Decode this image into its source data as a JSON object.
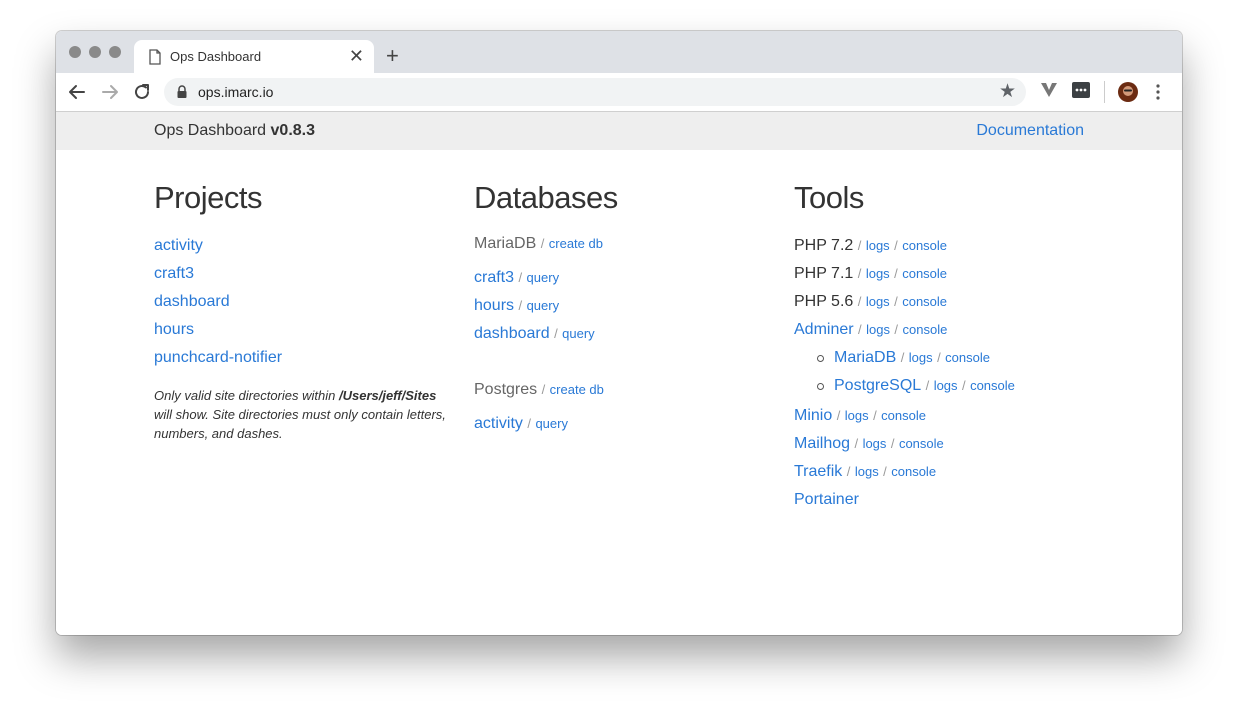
{
  "browser": {
    "tab_title": "Ops Dashboard",
    "url": "ops.imarc.io"
  },
  "header": {
    "app_name": "Ops Dashboard",
    "version": "v0.8.3",
    "documentation_link": "Documentation"
  },
  "projects": {
    "heading": "Projects",
    "items": [
      "activity",
      "craft3",
      "dashboard",
      "hours",
      "punchcard-notifier"
    ],
    "note_prefix": "Only valid site directories within",
    "note_path": "/Users/jeff/Sites",
    "note_suffix": "will show. Site directories must only contain letters, numbers, and dashes."
  },
  "databases": {
    "heading": "Databases",
    "mariadb": {
      "label": "MariaDB",
      "create": "create db",
      "dbs": [
        {
          "name": "craft3",
          "action": "query"
        },
        {
          "name": "hours",
          "action": "query"
        },
        {
          "name": "dashboard",
          "action": "query"
        }
      ]
    },
    "postgres": {
      "label": "Postgres",
      "create": "create db",
      "dbs": [
        {
          "name": "activity",
          "action": "query"
        }
      ]
    }
  },
  "tools": {
    "heading": "Tools",
    "separator": "/",
    "php": [
      {
        "name": "PHP 7.2",
        "logs": "logs",
        "console": "console"
      },
      {
        "name": "PHP 7.1",
        "logs": "logs",
        "console": "console"
      },
      {
        "name": "PHP 5.6",
        "logs": "logs",
        "console": "console"
      }
    ],
    "adminer": {
      "name": "Adminer",
      "logs": "logs",
      "console": "console"
    },
    "adminer_sub": [
      {
        "name": "MariaDB",
        "logs": "logs",
        "console": "console"
      },
      {
        "name": "PostgreSQL",
        "logs": "logs",
        "console": "console"
      }
    ],
    "services": [
      {
        "name": "Minio",
        "logs": "logs",
        "console": "console"
      },
      {
        "name": "Mailhog",
        "logs": "logs",
        "console": "console"
      },
      {
        "name": "Traefik",
        "logs": "logs",
        "console": "console"
      }
    ],
    "portainer": "Portainer"
  },
  "icons": {
    "back": "arrow-left-icon",
    "forward": "arrow-right-icon",
    "reload": "reload-icon",
    "lock": "lock-icon",
    "star": "star-icon"
  }
}
